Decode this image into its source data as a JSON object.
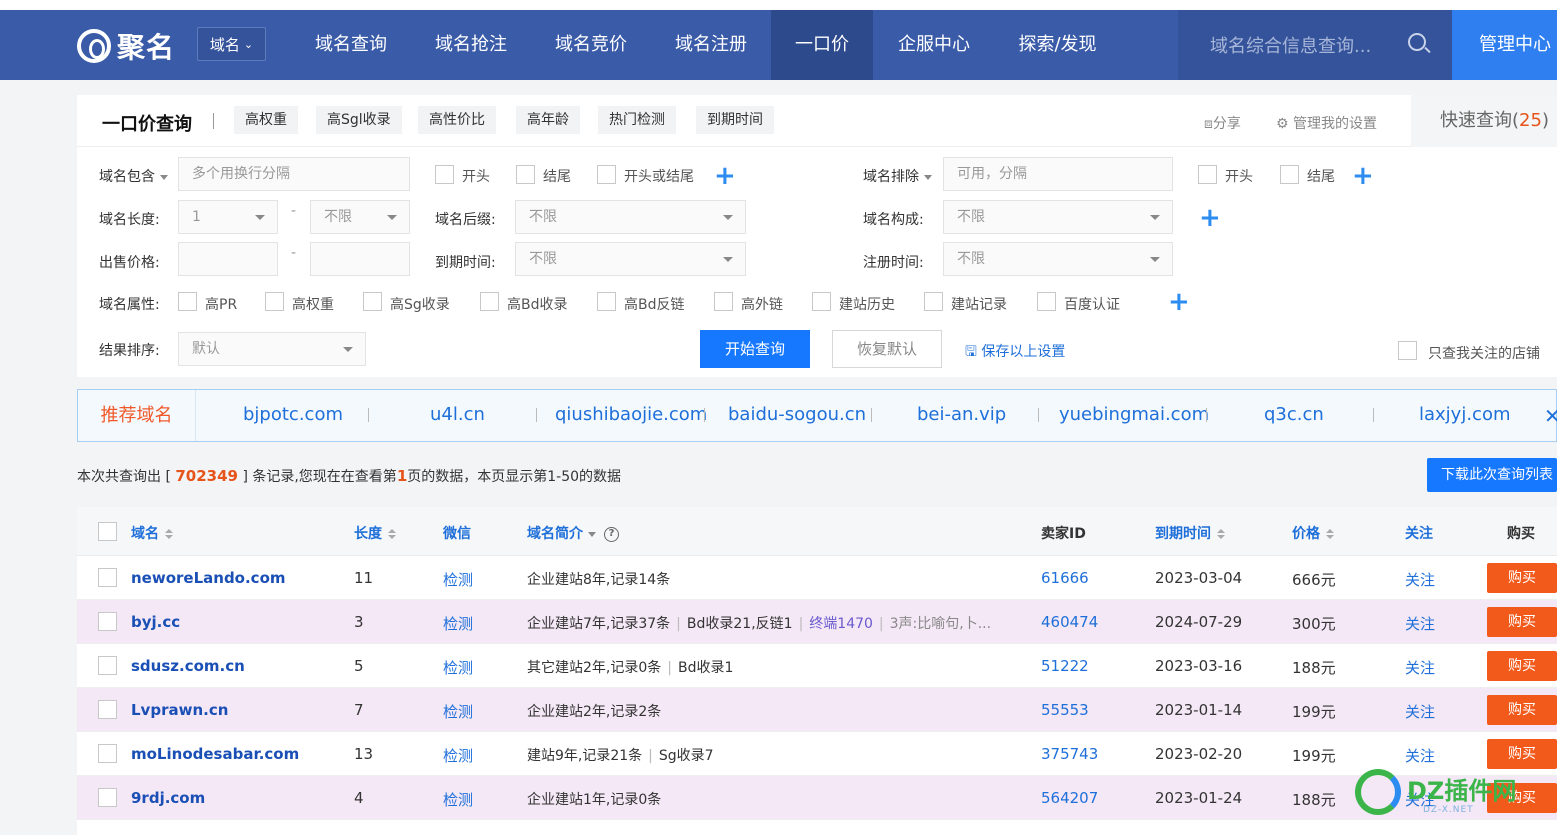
{
  "nav": {
    "logo_text": "聚名",
    "domain_switch": "域名",
    "items": [
      "域名查询",
      "域名抢注",
      "域名竞价",
      "域名注册",
      "一口价",
      "企服中心",
      "探索/发现"
    ],
    "search_placeholder": "域名综合信息查询...",
    "manage": "管理中心"
  },
  "tabs": {
    "title": "一口价查询",
    "quick": [
      "高权重",
      "高Sgl收录",
      "高性价比",
      "高年龄",
      "热门检测",
      "到期时间"
    ],
    "share": "分享",
    "settings": "管理我的设置",
    "quick_query_label": "快速查询(",
    "quick_query_count": "25",
    "quick_query_end": ")"
  },
  "filters": {
    "contains_label": "域名包含",
    "contains_placeholder": "多个用换行分隔",
    "start": "开头",
    "end": "结尾",
    "start_or_end": "开头或结尾",
    "exclude_label": "域名排除",
    "exclude_placeholder": "可用，分隔",
    "length_label": "域名长度:",
    "length_min": "1",
    "length_max": "不限",
    "suffix_label": "域名后缀:",
    "suffix_value": "不限",
    "compose_label": "域名构成:",
    "compose_value": "不限",
    "price_label": "出售价格:",
    "expire_label": "到期时间:",
    "expire_value": "不限",
    "reg_label": "注册时间:",
    "reg_value": "不限",
    "attr_label": "域名属性:",
    "attrs": [
      "高PR",
      "高权重",
      "高Sg收录",
      "高Bd收录",
      "高Bd反链",
      "高外链",
      "建站历史",
      "建站记录",
      "百度认证"
    ],
    "sort_label": "结果排序:",
    "sort_value": "默认",
    "search_btn": "开始查询",
    "reset_btn": "恢复默认",
    "save": "保存以上设置",
    "only_follow": "只查我关注的店铺",
    "dash": "-"
  },
  "recommend": {
    "title": "推荐域名",
    "items": [
      "bjpotc.com",
      "u4l.cn",
      "qiushibaojie.com",
      "baidu-sogou.cn",
      "bei-an.vip",
      "yuebingmai.com",
      "q3c.cn",
      "laxjyj.com"
    ]
  },
  "summary": {
    "p1": "本次共查询出 [ ",
    "count": "702349",
    "p2": " ] 条记录,您现在在查看第",
    "page": "1",
    "p3": "页的数据，本页显示第1-50的数据",
    "download": "下载此次查询列表"
  },
  "table": {
    "headers": {
      "domain": "域名",
      "length": "长度",
      "wechat": "微信",
      "intro": "域名简介",
      "seller": "卖家ID",
      "expire": "到期时间",
      "price": "价格",
      "follow": "关注",
      "buy": "购买"
    },
    "rows": [
      {
        "domain": "neworeLando.com",
        "length": "11",
        "wechat": "检测",
        "intro": [
          "企业建站8年,记录14条"
        ],
        "seller": "61666",
        "expire": "2023-03-04",
        "price": "666元",
        "follow": "关注",
        "buy": "购买"
      },
      {
        "domain": "byj.cc",
        "length": "3",
        "wechat": "检测",
        "intro": [
          "企业建站7年,记录37条",
          "Bd收录21,反链1",
          "终端1470",
          "3声:比喻句,卜..."
        ],
        "seller": "460474",
        "expire": "2024-07-29",
        "price": "300元",
        "follow": "关注",
        "buy": "购买"
      },
      {
        "domain": "sdusz.com.cn",
        "length": "5",
        "wechat": "检测",
        "intro": [
          "其它建站2年,记录0条",
          "Bd收录1"
        ],
        "seller": "51222",
        "expire": "2023-03-16",
        "price": "188元",
        "follow": "关注",
        "buy": "购买"
      },
      {
        "domain": "Lvprawn.cn",
        "length": "7",
        "wechat": "检测",
        "intro": [
          "企业建站2年,记录2条"
        ],
        "seller": "55553",
        "expire": "2023-01-14",
        "price": "199元",
        "follow": "关注",
        "buy": "购买"
      },
      {
        "domain": "moLinodesabar.com",
        "length": "13",
        "wechat": "检测",
        "intro": [
          "建站9年,记录21条",
          "Sg收录7"
        ],
        "seller": "375743",
        "expire": "2023-02-20",
        "price": "199元",
        "follow": "关注",
        "buy": "购买"
      },
      {
        "domain": "9rdj.com",
        "length": "4",
        "wechat": "检测",
        "intro": [
          "企业建站1年,记录0条"
        ],
        "seller": "564207",
        "expire": "2023-01-24",
        "price": "188元",
        "follow": "关注",
        "buy": "购买"
      }
    ]
  },
  "watermark": {
    "text": "DZ插件网",
    "sub": "DZ-X.NET"
  },
  "colors": {
    "nav": "#3a5ba8",
    "accent": "#1677ff",
    "buy": "#f25a1c",
    "highlight": "#e6541b"
  }
}
